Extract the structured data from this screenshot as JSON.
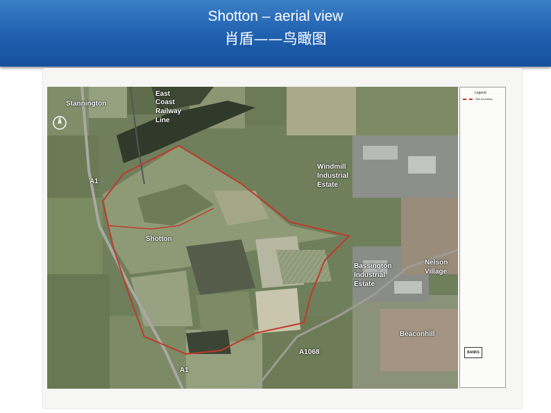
{
  "slide": {
    "title_en": "Shotton – aerial view",
    "title_zh": "肖盾——鸟瞰图"
  },
  "map": {
    "labels": {
      "stannington": "Stannington",
      "east_coast": "East",
      "coast": "Coast",
      "railway": "Railway",
      "line": "Line",
      "a1_north": "A1",
      "windmill": "Windmill",
      "industrial_1": "Industrial",
      "estate_1": "Estate",
      "shotton": "Shotton",
      "bassington": "Bassington",
      "industrial_2": "Industrial",
      "estate_2": "Estate",
      "nelson": "Nelson",
      "village": "Village",
      "beaconhill": "Beaconhill",
      "a1068": "A1068",
      "a1_south": "A1"
    },
    "legend": {
      "title": "Legend",
      "item": "Site boundary"
    },
    "logo_text": "BANKS",
    "boundary_color": "#c0392b"
  }
}
